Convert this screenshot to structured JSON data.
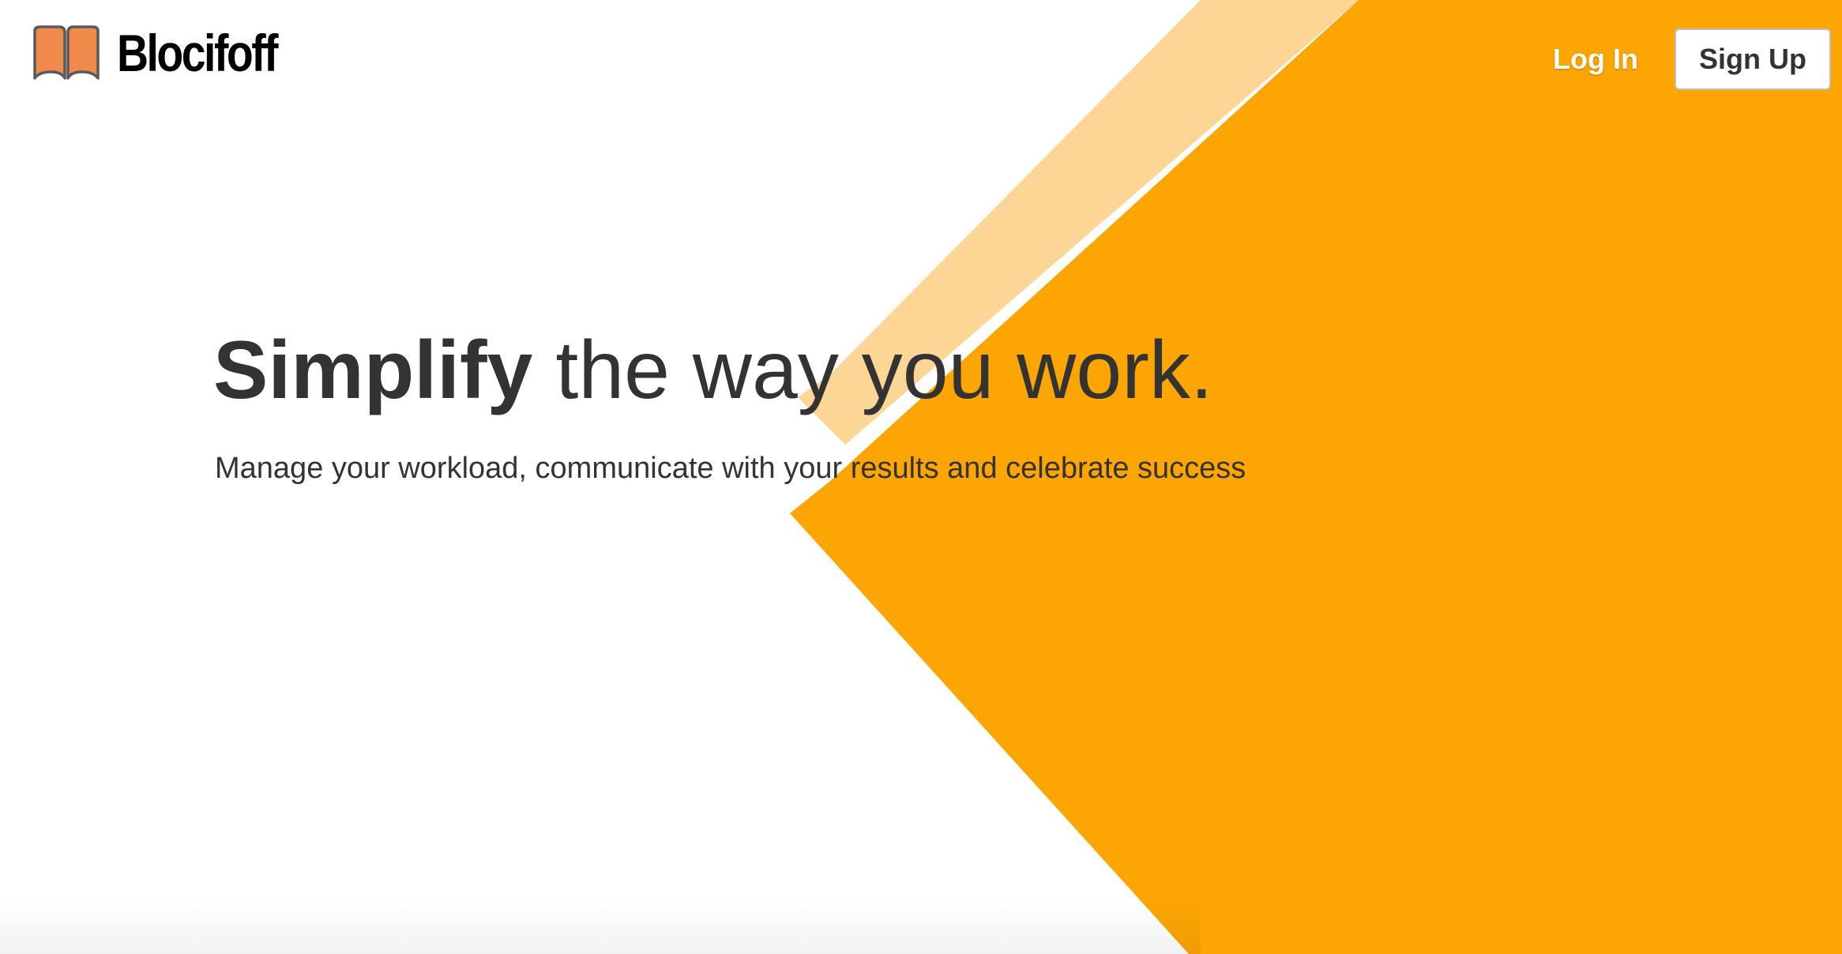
{
  "brand": {
    "name": "Blocifoff",
    "logo_icon": "open-book-icon",
    "logo_colors": {
      "fill": "#f08a4b",
      "outline": "#5a5a5a"
    }
  },
  "nav": {
    "login_label": "Log In",
    "signup_label": "Sign Up"
  },
  "hero": {
    "title_strong": "Simplify",
    "title_rest": " the way you work.",
    "subtitle": "Manage your workload, communicate with your results and celebrate success"
  },
  "colors": {
    "accent": "#fca503",
    "accent_light": "#fdd595",
    "text": "#333333",
    "background": "#ffffff"
  }
}
